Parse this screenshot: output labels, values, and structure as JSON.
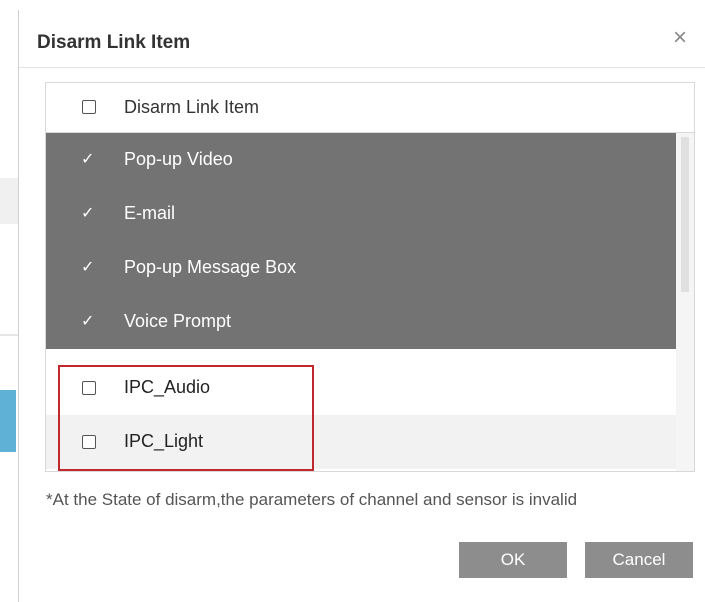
{
  "dialog": {
    "title": "Disarm Link Item",
    "close_glyph": "×"
  },
  "list": {
    "header_label": "Disarm Link Item",
    "header_checked": false,
    "items": [
      {
        "label": "Pop-up Video",
        "checked": true
      },
      {
        "label": "E-mail",
        "checked": true
      },
      {
        "label": "Pop-up Message Box",
        "checked": true
      },
      {
        "label": "Voice Prompt",
        "checked": true
      },
      {
        "label": "IPC_Audio",
        "checked": false
      },
      {
        "label": "IPC_Light",
        "checked": false
      }
    ],
    "check_glyph": "✓"
  },
  "note": "*At the State of disarm,the parameters of channel and sensor is invalid",
  "buttons": {
    "ok_label": "OK",
    "cancel_label": "Cancel"
  },
  "colors": {
    "checked_row_bg": "#737373",
    "highlight_border": "#c0282e",
    "button_bg": "#8d8d8d"
  }
}
